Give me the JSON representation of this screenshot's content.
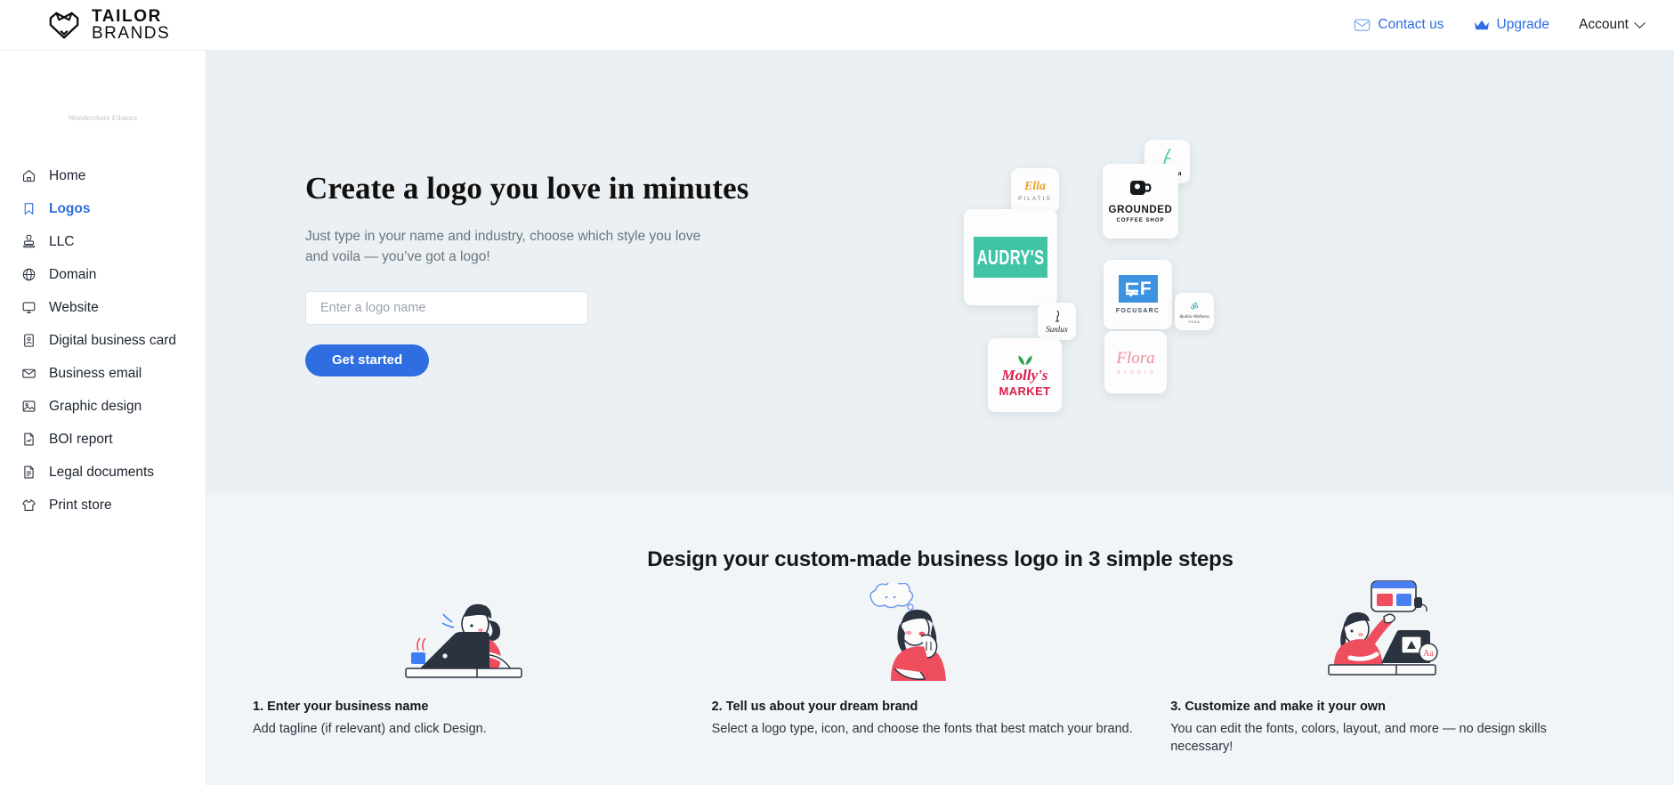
{
  "header": {
    "logo": {
      "line1": "TAILOR",
      "line2": "BRANDS",
      "icon": "tailor-brands-shield-icon"
    },
    "contact_label": "Contact us",
    "contact_icon": "mail-icon",
    "upgrade_label": "Upgrade",
    "upgrade_icon": "crown-icon",
    "account_label": "Account",
    "account_icon": "chevron-down-icon",
    "link_color": "#2f6ee0"
  },
  "sidebar": {
    "watermark": "Wondershare Filmora",
    "active_color": "#2f6ee0",
    "items": [
      {
        "label": "Home",
        "icon": "home-icon",
        "active": false
      },
      {
        "label": "Logos",
        "icon": "bookmark-icon",
        "active": true
      },
      {
        "label": "LLC",
        "icon": "stamp-icon",
        "active": false
      },
      {
        "label": "Domain",
        "icon": "globe-icon",
        "active": false
      },
      {
        "label": "Website",
        "icon": "monitor-icon",
        "active": false
      },
      {
        "label": "Digital business card",
        "icon": "id-card-icon",
        "active": false
      },
      {
        "label": "Business email",
        "icon": "envelope-icon",
        "active": false
      },
      {
        "label": "Graphic design",
        "icon": "image-icon",
        "active": false
      },
      {
        "label": "BOI report",
        "icon": "document-report-icon",
        "active": false
      },
      {
        "label": "Legal documents",
        "icon": "document-text-icon",
        "active": false
      },
      {
        "label": "Print store",
        "icon": "tshirt-icon",
        "active": false
      }
    ]
  },
  "hero": {
    "background": "#eaf0f3",
    "heading": "Create a logo you love in minutes",
    "subtext_line1": "Just type in your name and industry, choose which style you love",
    "subtext_line2": "and voila — you’ve got a logo!",
    "input_placeholder": "Enter a logo name",
    "input_value": "",
    "button_label": "Get started",
    "button_color": "#2f6ee0",
    "logo_cards": [
      {
        "name": "ella-pilatis",
        "title": "Ella",
        "subtitle": "PILATIS",
        "color": "#e8a22c"
      },
      {
        "name": "andrea",
        "title": "Andrea",
        "subtitle": "",
        "color": "#3ec4ad"
      },
      {
        "name": "grounded-coffee-shop",
        "title": "GROUNDED",
        "subtitle": "COFFEE SHOP",
        "color": "#15191c"
      },
      {
        "name": "audrys",
        "title": "AUDRY'S",
        "subtitle": "",
        "color": "#40c4a5"
      },
      {
        "name": "focusarc",
        "title": "FOCUSARC",
        "subtitle": "",
        "color": "#3d93e0"
      },
      {
        "name": "sunlux",
        "title": "Sunlux",
        "subtitle": "",
        "color": "#1c1c1c"
      },
      {
        "name": "ayahia-wellness-yoga",
        "title": "Ayahia Wellness",
        "subtitle": "YOGA",
        "color": "#1f9aa6"
      },
      {
        "name": "flora-studio",
        "title": "Flora",
        "subtitle": "S T U D I O",
        "color": "#ef8f9b"
      },
      {
        "name": "mollys-market",
        "title": "Molly's",
        "subtitle": "MARKET",
        "color": "#d9204e"
      }
    ]
  },
  "steps_section": {
    "background": "#f1f5f8",
    "heading": "Design your custom-made business logo in 3 simple steps",
    "steps": [
      {
        "title": "1. Enter your business name",
        "desc": "Add tagline (if relevant) and click Design.",
        "art": "woman-at-laptop-illustration"
      },
      {
        "title": "2. Tell us about your dream brand",
        "desc": "Select a logo type, icon, and choose the fonts that best match your brand.",
        "art": "woman-thinking-illustration"
      },
      {
        "title": "3. Customize and make it your own",
        "desc": "You can edit the fonts, colors, layout, and more — no design skills necessary!",
        "art": "woman-customizing-illustration"
      }
    ]
  }
}
